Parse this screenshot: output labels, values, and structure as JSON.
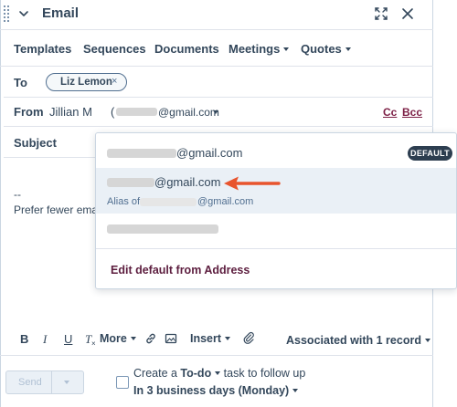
{
  "header": {
    "title": "Email",
    "icons": {
      "grip": "drag-handle-icon",
      "collapse": "chevron-down-icon",
      "expand": "expand-icon",
      "close": "close-icon"
    }
  },
  "tabs": [
    {
      "label": "Templates",
      "has_menu": false
    },
    {
      "label": "Sequences",
      "has_menu": false
    },
    {
      "label": "Documents",
      "has_menu": false
    },
    {
      "label": "Meetings",
      "has_menu": true
    },
    {
      "label": "Quotes",
      "has_menu": true
    }
  ],
  "to": {
    "label": "To",
    "recipient": "Liz Lemon",
    "remove_glyph": "×"
  },
  "from": {
    "label": "From",
    "name": "Jillian M",
    "open_paren": "(",
    "email_domain": "@gmail.com",
    "cc": "Cc",
    "bcc": "Bcc"
  },
  "subject": {
    "label": "Subject"
  },
  "signature": {
    "separator": "--",
    "line": "Prefer fewer email"
  },
  "from_dropdown": {
    "options": [
      {
        "email_domain": "@gmail.com",
        "badge": "DEFAULT",
        "selected": false
      },
      {
        "email_domain": "@gmail.com",
        "alias_prefix": "Alias of",
        "alias_domain": "@gmail.com",
        "selected": true
      }
    ],
    "edit_default": "Edit default from Address"
  },
  "toolbar": {
    "bold": "B",
    "italic": "I",
    "underline": "U",
    "clear_format": "T",
    "more": "More",
    "insert": "Insert",
    "associated": "Associated with 1 record"
  },
  "footer": {
    "send": "Send",
    "todo_prefix": "Create a ",
    "todo_type": "To-do",
    "todo_suffix": " task to follow up",
    "due": "In 3 business days (Monday)",
    "checked": false
  },
  "colors": {
    "text": "#33475b",
    "link": "#7c1f45",
    "badge_bg": "#2d3e50",
    "arrow": "#e8542d",
    "selected_row": "#eaf0f6"
  }
}
